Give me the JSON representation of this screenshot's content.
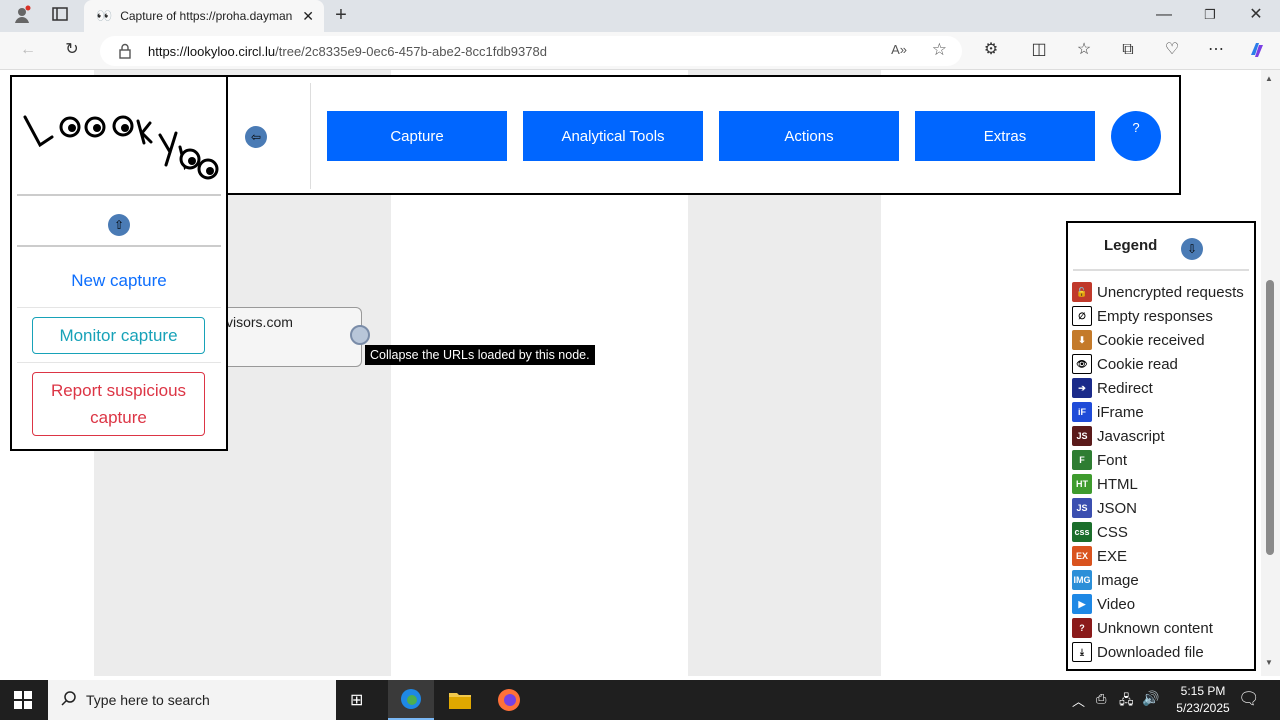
{
  "browser": {
    "tab_title": "Capture of https://proha.dayman",
    "url_host": "https://lookyloo.circl.lu",
    "url_path": "/tree/2c8335e9-0ec6-457b-abe2-8cc1fdb9378d"
  },
  "lookyloo": {
    "logo_text": "Lookyloo",
    "menu": {
      "new_capture": "New capture",
      "monitor_capture": "Monitor capture",
      "report_capture": "Report suspicious capture"
    },
    "top_buttons": [
      "Capture",
      "Analytical Tools",
      "Actions",
      "Extras"
    ],
    "help_label": "?",
    "node_label": "visors.com",
    "tooltip": "Collapse the URLs loaded by this node.",
    "legend": {
      "title": "Legend",
      "items": [
        {
          "label": "Unencrypted requests",
          "icon": "unlocked-icon",
          "color": "#c0392b"
        },
        {
          "label": "Empty responses",
          "icon": "empty-set-icon",
          "color": "#000000"
        },
        {
          "label": "Cookie received",
          "icon": "cookie-received-icon",
          "color": "#c47a2a"
        },
        {
          "label": "Cookie read",
          "icon": "eye-icon",
          "color": "#000000"
        },
        {
          "label": "Redirect",
          "icon": "redirect-icon",
          "color": "#1a2a8a"
        },
        {
          "label": "iFrame",
          "icon": "iframe-icon",
          "color": "#1f4bd8"
        },
        {
          "label": "Javascript",
          "icon": "javascript-icon",
          "color": "#5a1a1a"
        },
        {
          "label": "Font",
          "icon": "font-icon",
          "color": "#2e7d32"
        },
        {
          "label": "HTML",
          "icon": "html-icon",
          "color": "#3e9b2e"
        },
        {
          "label": "JSON",
          "icon": "json-icon",
          "color": "#3b4fb0"
        },
        {
          "label": "CSS",
          "icon": "css-icon",
          "color": "#1b6e2b"
        },
        {
          "label": "EXE",
          "icon": "exe-icon",
          "color": "#d9531e"
        },
        {
          "label": "Image",
          "icon": "image-icon",
          "color": "#2b8fd8"
        },
        {
          "label": "Video",
          "icon": "video-icon",
          "color": "#1e88e5"
        },
        {
          "label": "Unknown content",
          "icon": "unknown-content-icon",
          "color": "#8b1a1a"
        },
        {
          "label": "Downloaded file",
          "icon": "download-icon",
          "color": "#000000"
        }
      ]
    }
  },
  "taskbar": {
    "search_placeholder": "Type here to search",
    "time": "5:15 PM",
    "date": "5/23/2025"
  },
  "colors": {
    "primary_blue": "#0066ff",
    "monitor_cyan": "#17a2b8",
    "report_red": "#dc3545",
    "link_blue": "#0d6efd"
  }
}
